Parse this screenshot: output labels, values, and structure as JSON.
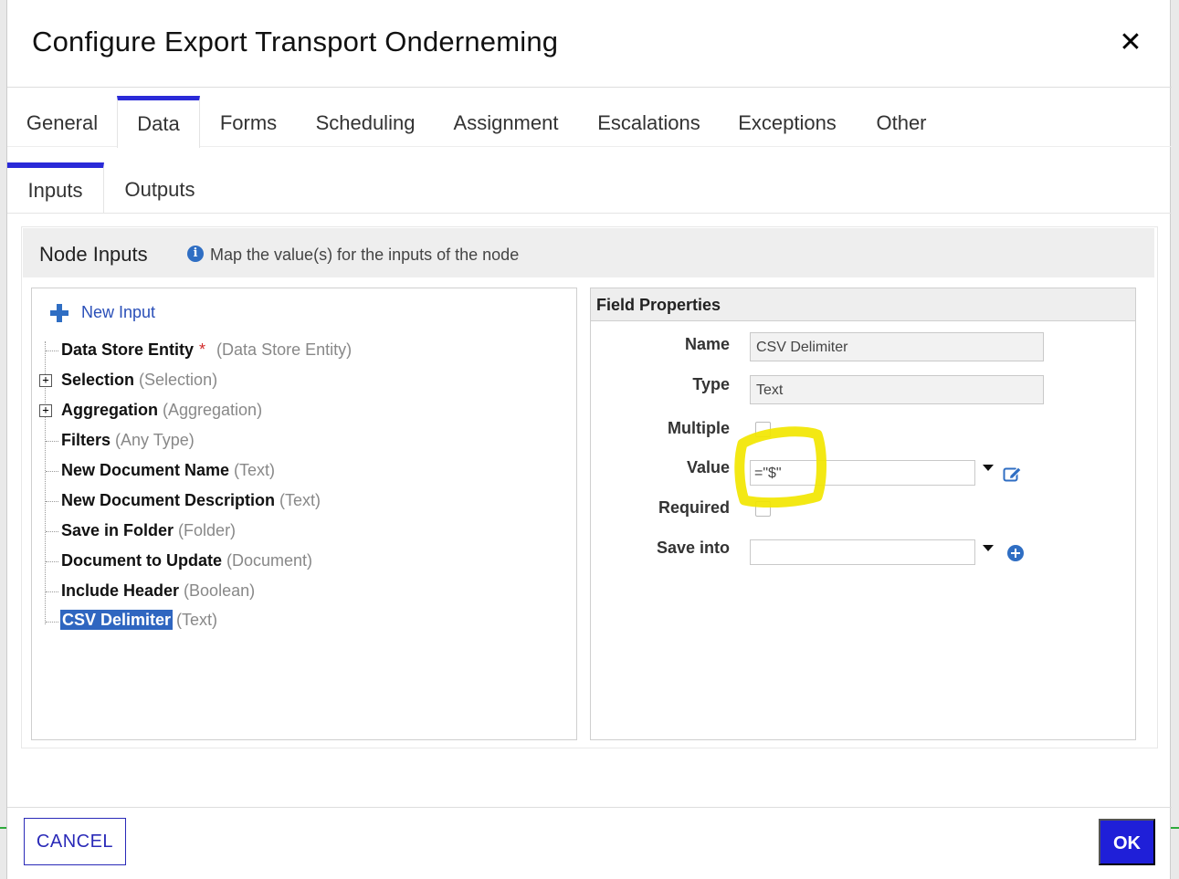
{
  "dialog": {
    "title": "Configure Export Transport Onderneming"
  },
  "tabs": [
    {
      "label": "General"
    },
    {
      "label": "Data",
      "active": true
    },
    {
      "label": "Forms"
    },
    {
      "label": "Scheduling"
    },
    {
      "label": "Assignment"
    },
    {
      "label": "Escalations"
    },
    {
      "label": "Exceptions"
    },
    {
      "label": "Other"
    }
  ],
  "subtabs": [
    {
      "label": "Inputs",
      "active": true
    },
    {
      "label": "Outputs"
    }
  ],
  "node_inputs": {
    "title": "Node Inputs",
    "info": "Map the value(s) for the inputs of the node",
    "new_input_label": "New Input",
    "items": [
      {
        "name": "Data Store Entity",
        "required": "*",
        "type": "(Data Store Entity)"
      },
      {
        "name": "Selection",
        "type": "(Selection)",
        "expandable": true
      },
      {
        "name": "Aggregation",
        "type": "(Aggregation)",
        "expandable": true
      },
      {
        "name": "Filters",
        "type": "(Any Type)"
      },
      {
        "name": "New Document Name",
        "type": "(Text)"
      },
      {
        "name": "New Document Description",
        "type": "(Text)"
      },
      {
        "name": "Save in Folder",
        "type": "(Folder)"
      },
      {
        "name": "Document to Update",
        "type": "(Document)"
      },
      {
        "name": "Include Header",
        "type": "(Boolean)"
      },
      {
        "name": "CSV Delimiter",
        "type": "(Text)",
        "selected": true
      }
    ],
    "expand_symbol": "+"
  },
  "field_properties": {
    "title": "Field Properties",
    "name_label": "Name",
    "name_value": "CSV Delimiter",
    "type_label": "Type",
    "type_value": "Text",
    "multiple_label": "Multiple",
    "multiple_checked": false,
    "value_label": "Value",
    "value_value": "=\"$\"",
    "required_label": "Required",
    "required_checked": false,
    "save_into_label": "Save into",
    "save_into_value": ""
  },
  "footer": {
    "cancel_label": "CANCEL",
    "ok_label": "OK"
  },
  "icons": {
    "close": "close-icon",
    "info": "info-icon",
    "new_input": "plus-icon",
    "value_edit": "edit-icon",
    "save_into_add": "add-circle-icon"
  },
  "colors": {
    "accent": "#2a2ad8",
    "selected": "#2f66c0",
    "link": "#2a4fb8",
    "required": "#d12b2b",
    "highlight": "#f2e600"
  }
}
